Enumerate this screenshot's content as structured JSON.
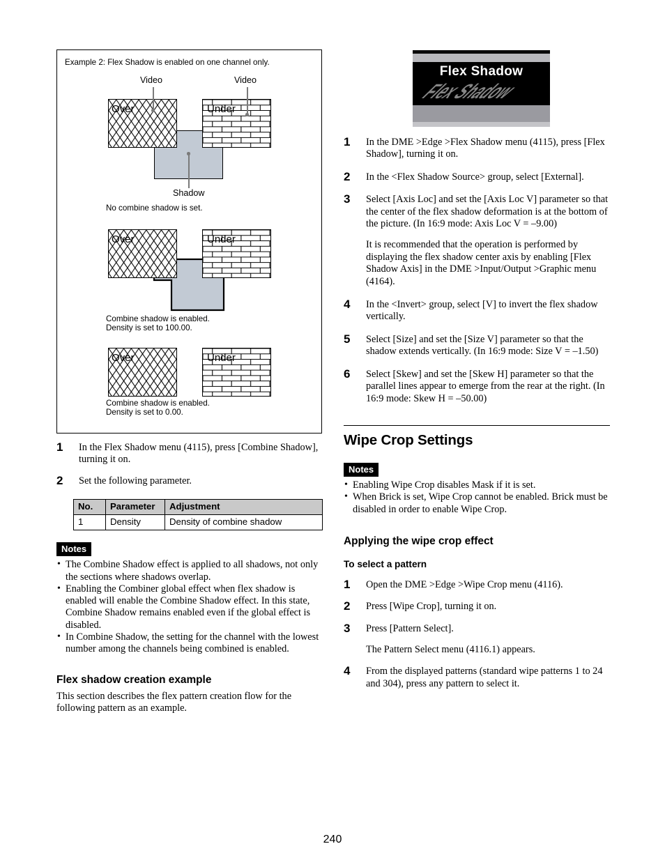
{
  "page": {
    "number": "240"
  },
  "figure": {
    "caption": "Example 2: Flex Shadow is enabled on one channel only.",
    "labels": {
      "video_left": "Video",
      "video_right": "Video",
      "over": "Over",
      "under": "Under",
      "shadow": "Shadow"
    },
    "examples": [
      {
        "caption_line1": "No combine shadow is set.",
        "caption_line2": ""
      },
      {
        "caption_line1": "Combine shadow is enabled.",
        "caption_line2": "Density is set to 100.00."
      },
      {
        "caption_line1": "Combine shadow is enabled.",
        "caption_line2": "Density is set to 0.00."
      }
    ]
  },
  "left_column": {
    "steps": [
      {
        "num": "1",
        "text": "In the Flex Shadow menu (4115), press [Combine Shadow], turning it on."
      },
      {
        "num": "2",
        "text": "Set the following parameter."
      }
    ],
    "table": {
      "headers": [
        "No.",
        "Parameter",
        "Adjustment"
      ],
      "rows": [
        [
          "1",
          "Density",
          "Density of combine shadow"
        ]
      ]
    },
    "notes_label": "Notes",
    "notes": [
      "The Combine Shadow effect is applied to all shadows, not only the sections where shadows overlap.",
      "Enabling the Combiner global effect when flex shadow is enabled will enable the Combine Shadow effect. In this state, Combine Shadow remains enabled even if the global effect is disabled.",
      "In Combine Shadow, the setting for the channel with the lowest number among the channels being combined is enabled."
    ],
    "subheading": "Flex shadow creation example",
    "intro": "This section describes the flex pattern creation flow for the following pattern as an example."
  },
  "right_column": {
    "screenshot": {
      "title": "Flex Shadow",
      "reflection": "Flex Shadow"
    },
    "steps": [
      {
        "num": "1",
        "paras": [
          "In the DME >Edge >Flex Shadow menu (4115), press [Flex Shadow], turning it on."
        ]
      },
      {
        "num": "2",
        "paras": [
          "In the <Flex Shadow Source> group, select [External]."
        ]
      },
      {
        "num": "3",
        "paras": [
          "Select [Axis Loc] and set the [Axis Loc V] parameter so that the center of the flex shadow deformation is at the bottom of the picture. (In 16:9 mode: Axis Loc V = –9.00)",
          "It is recommended that the operation is performed by displaying the flex shadow center axis by enabling [Flex Shadow Axis] in the DME >Input/Output >Graphic menu (4164)."
        ]
      },
      {
        "num": "4",
        "paras": [
          "In the <Invert> group, select [V] to invert the flex shadow vertically."
        ]
      },
      {
        "num": "5",
        "paras": [
          "Select [Size] and set the [Size V] parameter so that the shadow extends vertically. (In 16:9 mode: Size V = –1.50)"
        ]
      },
      {
        "num": "6",
        "paras": [
          "Select [Skew] and set the [Skew H] parameter so that the parallel lines appear to emerge from the rear at the right. (In 16:9 mode: Skew H = –50.00)"
        ]
      }
    ],
    "section_title": "Wipe Crop Settings",
    "notes_label": "Notes",
    "notes": [
      "Enabling Wipe Crop disables Mask if it is set.",
      "When Brick is set, Wipe Crop cannot be enabled. Brick must be disabled in order to enable Wipe Crop."
    ],
    "subheading": "Applying the wipe crop effect",
    "subsubheading": "To select a pattern",
    "pattern_steps": [
      {
        "num": "1",
        "paras": [
          "Open the DME >Edge >Wipe Crop menu (4116)."
        ]
      },
      {
        "num": "2",
        "paras": [
          "Press [Wipe Crop], turning it on."
        ]
      },
      {
        "num": "3",
        "paras": [
          "Press [Pattern Select].",
          "The Pattern Select menu (4116.1) appears."
        ]
      },
      {
        "num": "4",
        "paras": [
          "From the displayed patterns (standard wipe patterns 1 to 24 and 304), press any pattern to select it."
        ]
      }
    ]
  }
}
